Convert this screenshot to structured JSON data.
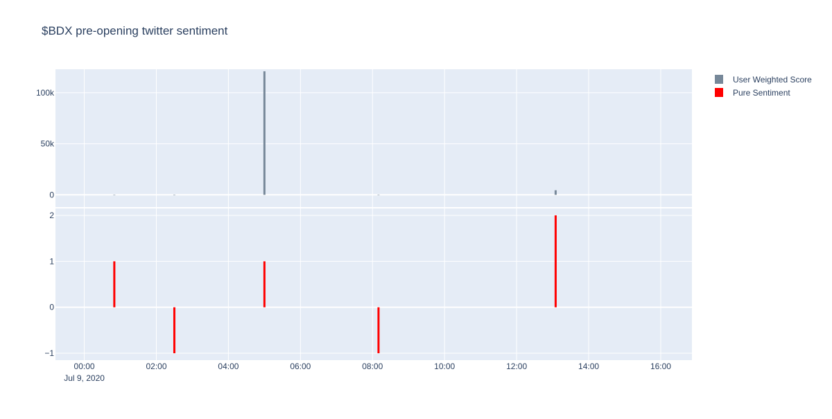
{
  "chart_data": {
    "type": "bar",
    "title": "$BDX pre-opening twitter sentiment",
    "x_axis": {
      "type": "time",
      "ticks": [
        {
          "value": "2020-07-09 00:00",
          "label": "00:00",
          "sublabel": "Jul 9, 2020"
        },
        {
          "value": "2020-07-09 02:00",
          "label": "02:00"
        },
        {
          "value": "2020-07-09 04:00",
          "label": "04:00"
        },
        {
          "value": "2020-07-09 06:00",
          "label": "06:00"
        },
        {
          "value": "2020-07-09 08:00",
          "label": "08:00"
        },
        {
          "value": "2020-07-09 10:00",
          "label": "10:00"
        },
        {
          "value": "2020-07-09 12:00",
          "label": "12:00"
        },
        {
          "value": "2020-07-09 14:00",
          "label": "14:00"
        },
        {
          "value": "2020-07-09 16:00",
          "label": "16:00"
        }
      ],
      "range": [
        "2020-07-08 23:12",
        "2020-07-09 16:52"
      ]
    },
    "subplots": [
      {
        "series_name": "User Weighted Score",
        "color": "#778899",
        "ylim": [
          -12000,
          123000
        ],
        "y_ticks": [
          {
            "value": 0,
            "label": "0"
          },
          {
            "value": 50000,
            "label": "50k"
          },
          {
            "value": 100000,
            "label": "100k"
          }
        ],
        "points": [
          {
            "x": "2020-07-09 00:50",
            "y": 150
          },
          {
            "x": "2020-07-09 02:30",
            "y": -150
          },
          {
            "x": "2020-07-09 05:00",
            "y": 121000
          },
          {
            "x": "2020-07-09 08:10",
            "y": -150
          },
          {
            "x": "2020-07-09 13:05",
            "y": 4500
          }
        ]
      },
      {
        "series_name": "Pure Sentiment",
        "color": "#ff0000",
        "ylim": [
          -1.15,
          2.15
        ],
        "y_ticks": [
          {
            "value": -1,
            "label": "−1"
          },
          {
            "value": 0,
            "label": "0"
          },
          {
            "value": 1,
            "label": "1"
          },
          {
            "value": 2,
            "label": "2"
          }
        ],
        "points": [
          {
            "x": "2020-07-09 00:50",
            "y": 1
          },
          {
            "x": "2020-07-09 02:30",
            "y": -1
          },
          {
            "x": "2020-07-09 05:00",
            "y": 1
          },
          {
            "x": "2020-07-09 08:10",
            "y": -1
          },
          {
            "x": "2020-07-09 13:05",
            "y": 2
          }
        ]
      }
    ],
    "legend": {
      "placement": "top-right",
      "items": [
        {
          "name": "User Weighted Score",
          "color": "#778899"
        },
        {
          "name": "Pure Sentiment",
          "color": "#ff0000"
        }
      ]
    },
    "plot_background": "#e5ecf6",
    "grid": true
  }
}
